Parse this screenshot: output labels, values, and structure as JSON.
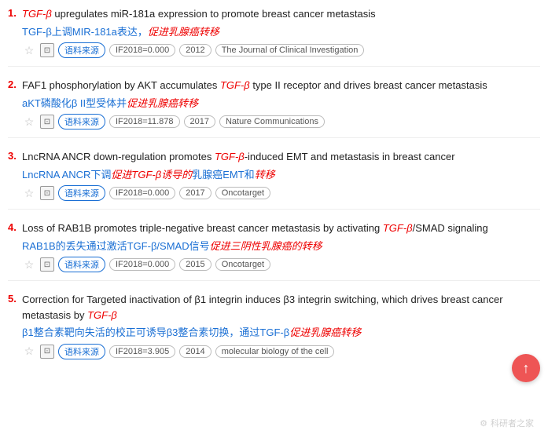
{
  "items": [
    {
      "number": "1.",
      "title_en_parts": [
        {
          "text": "TGF-β",
          "type": "italic-red"
        },
        {
          "text": " upregulates miR-181a expression to promote breast cancer metastasis",
          "type": "normal"
        }
      ],
      "title_cn_parts": [
        {
          "text": "TGF-β上调MIR-181a表达，",
          "type": "normal-blue"
        },
        {
          "text": "促进乳腺癌转移",
          "type": "italic-red"
        }
      ],
      "if": "IF2018=0.000",
      "year": "2012",
      "journal": "The Journal of Clinical Investigation"
    },
    {
      "number": "2.",
      "title_en_parts": [
        {
          "text": "FAF1 phosphorylation by AKT accumulates ",
          "type": "normal"
        },
        {
          "text": "TGF-β",
          "type": "italic-red"
        },
        {
          "text": " type II receptor and drives breast cancer metastasis",
          "type": "normal"
        }
      ],
      "title_cn_parts": [
        {
          "text": "aKT磷酸化β II型受体并",
          "type": "normal-blue"
        },
        {
          "text": "促进乳腺癌转移",
          "type": "italic-red"
        }
      ],
      "if": "IF2018=11.878",
      "year": "2017",
      "journal": "Nature Communications"
    },
    {
      "number": "3.",
      "title_en_parts": [
        {
          "text": "LncRNA ANCR down-regulation promotes ",
          "type": "normal"
        },
        {
          "text": "TGF-β",
          "type": "italic-red"
        },
        {
          "text": "-induced EMT and metastasis in breast cancer",
          "type": "normal"
        }
      ],
      "title_cn_parts": [
        {
          "text": "LncRNA ANCR下调",
          "type": "normal-blue"
        },
        {
          "text": "促进TGF-β诱导的",
          "type": "italic-red"
        },
        {
          "text": "乳腺癌",
          "type": "normal-blue"
        },
        {
          "text": "EMT和",
          "type": "normal-blue"
        },
        {
          "text": "转移",
          "type": "italic-red"
        }
      ],
      "if": "IF2018=0.000",
      "year": "2017",
      "journal": "Oncotarget"
    },
    {
      "number": "4.",
      "title_en_parts": [
        {
          "text": "Loss of RAB1B promotes triple-negative breast cancer metastasis by activating ",
          "type": "normal"
        },
        {
          "text": "TGF-β",
          "type": "italic-red"
        },
        {
          "text": "/SMAD signaling",
          "type": "normal"
        }
      ],
      "title_cn_parts": [
        {
          "text": "RAB1B的丢失通过激活TGF-β/SMAD信号",
          "type": "normal-blue"
        },
        {
          "text": "促进三阴性乳腺癌的",
          "type": "italic-red"
        },
        {
          "text": "转移",
          "type": "italic-red"
        }
      ],
      "if": "IF2018=0.000",
      "year": "2015",
      "journal": "Oncotarget"
    },
    {
      "number": "5.",
      "title_en_parts": [
        {
          "text": "Correction for Targeted inactivation of β1 integrin induces β3 integrin switching, which drives breast cancer metastasis by ",
          "type": "normal"
        },
        {
          "text": "TGF-β",
          "type": "italic-red"
        }
      ],
      "title_cn_parts": [
        {
          "text": "β1整合素靶向失活的校正可诱导β3整合素切换，通过TGF-β",
          "type": "normal-blue"
        },
        {
          "text": "促进乳腺癌转移",
          "type": "italic-red"
        }
      ],
      "if": "IF2018=3.905",
      "year": "2014",
      "journal": "molecular biology of the cell"
    }
  ],
  "labels": {
    "source": "语料来源",
    "scroll_up": "↑",
    "watermark": "科研者之家"
  }
}
